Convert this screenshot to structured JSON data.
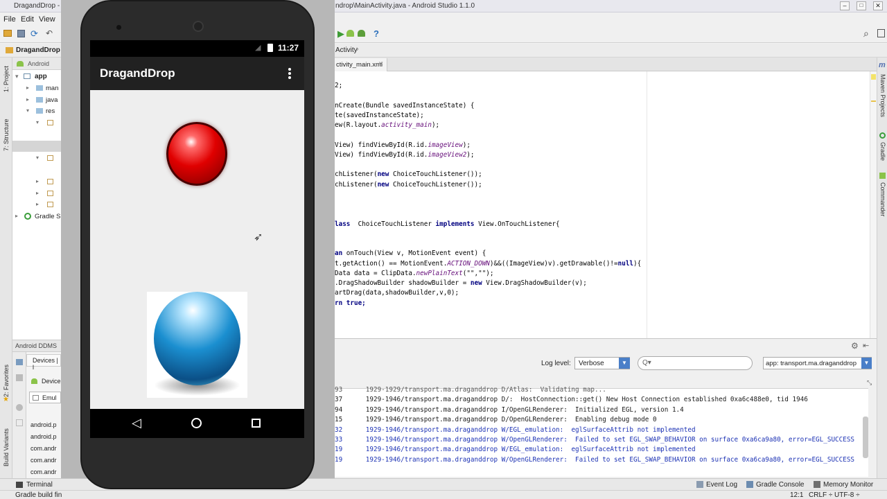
{
  "window": {
    "title_left": "DragandDrop - ",
    "title_right": "ndrop\\MainActivity.java - Android Studio 1.1.0"
  },
  "menu": {
    "file": "File",
    "edit": "Edit",
    "view": "View"
  },
  "navbar": {
    "project": "DragandDrop",
    "crumb": "Activity"
  },
  "left_tools": {
    "project": "1: Project",
    "structure": "7: Structure",
    "favorites": "2: Favorites",
    "build_variants": "Build Variants"
  },
  "project_panel": {
    "view_mode": "Android",
    "tree": [
      {
        "label": "app",
        "bold": true
      },
      {
        "label": "man"
      },
      {
        "label": "java"
      },
      {
        "label": "res"
      },
      {
        "label": "Gradle S"
      }
    ]
  },
  "ddms": {
    "title": "Android DDMS",
    "devices_tab": "Devices | l",
    "device_label": "Device",
    "emulator_label": "Emul",
    "processes": [
      "android.p",
      "android.p",
      "com.andr",
      "com.andr",
      "com.andr"
    ]
  },
  "editor": {
    "tabs": [
      {
        "label": "ctivity_main.xml",
        "closable": true
      }
    ],
    "code_lines": [
      {
        "segments": [
          {
            "t": "2;"
          }
        ]
      },
      {
        "segments": [
          {
            "t": ""
          }
        ]
      },
      {
        "segments": [
          {
            "t": "nCreate(Bundle savedInstanceState) {"
          }
        ]
      },
      {
        "segments": [
          {
            "t": "te(savedInstanceState);"
          }
        ]
      },
      {
        "segments": [
          {
            "t": "ew(R.layout."
          },
          {
            "t": "activity_main",
            "c": "it"
          },
          {
            "t": ");"
          }
        ]
      },
      {
        "segments": [
          {
            "t": ""
          }
        ]
      },
      {
        "segments": [
          {
            "t": "View) findViewById(R.id."
          },
          {
            "t": "imageView",
            "c": "it"
          },
          {
            "t": ");"
          }
        ]
      },
      {
        "segments": [
          {
            "t": "View) findViewById(R.id."
          },
          {
            "t": "imageView2",
            "c": "it"
          },
          {
            "t": ");"
          }
        ]
      },
      {
        "segments": [
          {
            "t": ""
          }
        ]
      },
      {
        "segments": [
          {
            "t": "chListener("
          },
          {
            "t": "new",
            "c": "kw"
          },
          {
            "t": " ChoiceTouchListener());"
          }
        ]
      },
      {
        "segments": [
          {
            "t": "chListener("
          },
          {
            "t": "new",
            "c": "kw"
          },
          {
            "t": " ChoiceTouchListener());"
          }
        ]
      },
      {
        "segments": [
          {
            "t": ""
          }
        ]
      },
      {
        "segments": [
          {
            "t": ""
          }
        ]
      },
      {
        "segments": [
          {
            "t": ""
          }
        ]
      },
      {
        "segments": [
          {
            "t": "lass",
            "c": "kw"
          },
          {
            "t": "  ChoiceTouchListener "
          },
          {
            "t": "implements",
            "c": "kw"
          },
          {
            "t": " View.OnTouchListener{"
          }
        ]
      },
      {
        "segments": [
          {
            "t": ""
          }
        ]
      },
      {
        "segments": [
          {
            "t": ""
          }
        ]
      },
      {
        "segments": [
          {
            "t": "an",
            "c": "kw"
          },
          {
            "t": " onTouch(View v, MotionEvent event) {"
          }
        ]
      },
      {
        "segments": [
          {
            "t": "t.getAction() == MotionEvent."
          },
          {
            "t": "ACTION_DOWN",
            "c": "it"
          },
          {
            "t": ")&&((ImageView)v).getDrawable()!="
          },
          {
            "t": "null",
            "c": "kw"
          },
          {
            "t": "){"
          }
        ]
      },
      {
        "segments": [
          {
            "t": "Data data = ClipData."
          },
          {
            "t": "newPlainText",
            "c": "it"
          },
          {
            "t": "(\"\",\"\");"
          }
        ]
      },
      {
        "segments": [
          {
            "t": ".DragShadowBuilder shadowBuilder = "
          },
          {
            "t": "new",
            "c": "kw"
          },
          {
            "t": " View.DragShadowBuilder(v);"
          }
        ]
      },
      {
        "segments": [
          {
            "t": "artDrag(data,shadowBuilder,v,0);"
          }
        ]
      },
      {
        "segments": [
          {
            "t": "rn true;",
            "c": "kw"
          }
        ]
      }
    ]
  },
  "logcat": {
    "log_level_label": "Log level:",
    "log_level_value": "Verbose",
    "search_placeholder": "Q▾",
    "app_filter": "app: transport.ma.draganddrop",
    "lines": [
      {
        "n": "93",
        "pid": "1929-1929/transport.ma.draganddrop D/Atlas:",
        "msg": "Validating map...",
        "color": "#555555"
      },
      {
        "n": "37",
        "pid": "1929-1946/transport.ma.draganddrop D/:",
        "msg": "HostConnection::get() New Host Connection established 0xa6c488e0, tid 1946",
        "color": "#1a1a1a"
      },
      {
        "n": "94",
        "pid": "1929-1946/transport.ma.draganddrop I/OpenGLRenderer:",
        "msg": "Initialized EGL, version 1.4",
        "color": "#1a1a1a"
      },
      {
        "n": "15",
        "pid": "1929-1946/transport.ma.draganddrop D/OpenGLRenderer:",
        "msg": "Enabling debug mode 0",
        "color": "#1a1a1a"
      },
      {
        "n": "32",
        "pid": "1929-1946/transport.ma.draganddrop W/EGL_emulation:",
        "msg": "eglSurfaceAttrib not implemented",
        "color": "#1c32b4"
      },
      {
        "n": "33",
        "pid": "1929-1946/transport.ma.draganddrop W/OpenGLRenderer:",
        "msg": "Failed to set EGL_SWAP_BEHAVIOR on surface 0xa6ca9a80, error=EGL_SUCCESS",
        "color": "#1c32b4"
      },
      {
        "n": "19",
        "pid": "1929-1946/transport.ma.draganddrop W/EGL_emulation:",
        "msg": "eglSurfaceAttrib not implemented",
        "color": "#1c32b4"
      },
      {
        "n": "19",
        "pid": "1929-1946/transport.ma.draganddrop W/OpenGLRenderer:",
        "msg": "Failed to set EGL_SWAP_BEHAVIOR on surface 0xa6ca9a80, error=EGL_SUCCESS",
        "color": "#1c32b4"
      }
    ]
  },
  "right_tools": {
    "maven": "Maven Projects",
    "gradle": "Gradle",
    "commander": "Commander"
  },
  "bottom_tabs": {
    "terminal": "Terminal",
    "event_log": "Event Log",
    "gradle_console": "Gradle Console",
    "memory_monitor": "Memory Monitor"
  },
  "status": {
    "message": "Gradle build fin",
    "position": "12:1",
    "line_sep": "CRLF ÷",
    "encoding": "UTF-8 ÷"
  },
  "phone": {
    "clock": "11:27",
    "app_title": "DragandDrop",
    "red_ball_color": "#e00000",
    "blue_ball_color": "#1b8fd0"
  }
}
